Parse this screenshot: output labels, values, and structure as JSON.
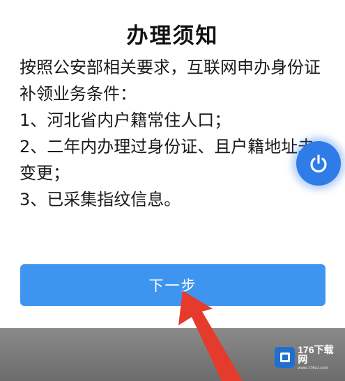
{
  "dialog": {
    "title": "办理须知",
    "paragraphs": [
      "按照公安部相关要求，互联网申办身份证补领业务条件：",
      "1、河北省内户籍常住人口；",
      "2、二年内办理过身份证、且户籍地址未变更；",
      "3、已采集指纹信息。"
    ],
    "next_button_label": "下一步"
  },
  "floating_button": {
    "icon": "power-icon",
    "color": "#2f7ce8"
  },
  "overlay": {
    "arrow_color": "#e53b2c",
    "watermark_name": "176下载网",
    "watermark_url": "www.176xz.com"
  },
  "colors": {
    "button_background": "#3e95ef",
    "button_text": "#ffffff",
    "title_text": "#111111"
  }
}
